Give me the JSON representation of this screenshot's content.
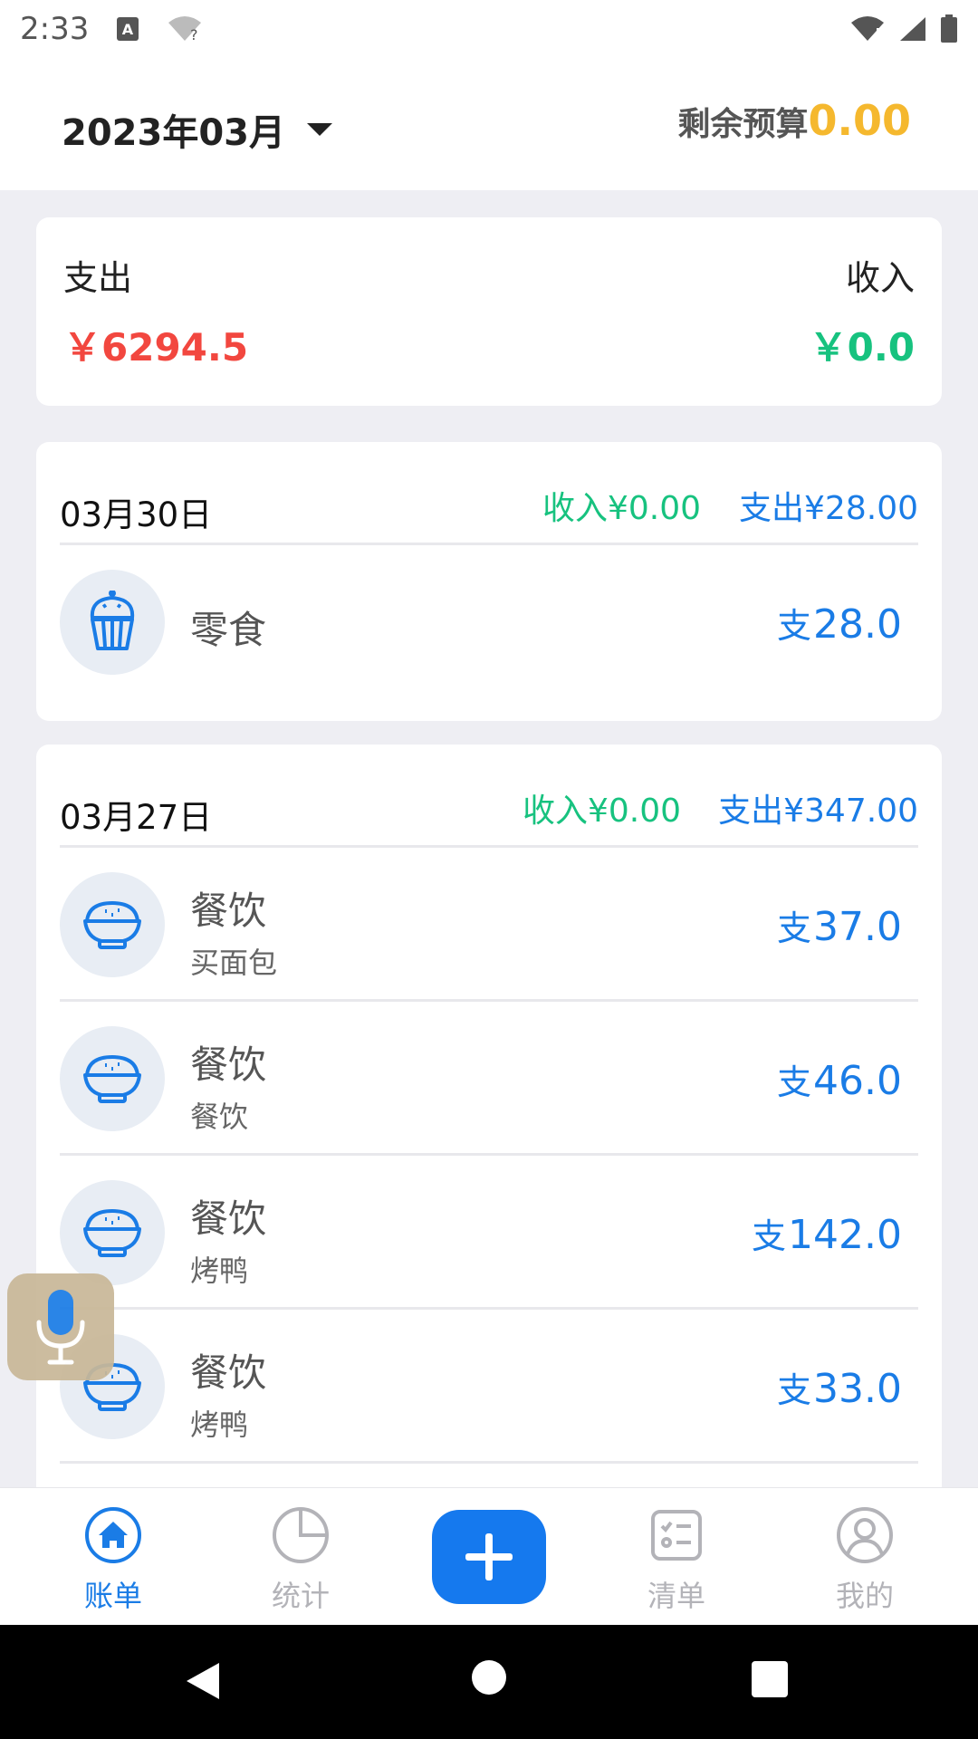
{
  "status_bar": {
    "time": "2:33"
  },
  "header": {
    "month": "2023年03月",
    "budget_label": "剩余预算",
    "budget_value": "0.00"
  },
  "summary": {
    "expense_label": "支出",
    "expense_value": "￥6294.5",
    "income_label": "收入",
    "income_value": "￥0.0"
  },
  "days": [
    {
      "date": "03月30日",
      "income": "收入¥0.00",
      "expense": "支出¥28.00",
      "items": [
        {
          "icon": "cupcake-icon",
          "category": "零食",
          "note": "",
          "prefix": "支",
          "amount": "28.0"
        }
      ]
    },
    {
      "date": "03月27日",
      "income": "收入¥0.00",
      "expense": "支出¥347.00",
      "items": [
        {
          "icon": "rice-bowl-icon",
          "category": "餐饮",
          "note": "买面包",
          "prefix": "支",
          "amount": "37.0"
        },
        {
          "icon": "rice-bowl-icon",
          "category": "餐饮",
          "note": "餐饮",
          "prefix": "支",
          "amount": "46.0"
        },
        {
          "icon": "rice-bowl-icon",
          "category": "餐饮",
          "note": "烤鸭",
          "prefix": "支",
          "amount": "142.0"
        },
        {
          "icon": "rice-bowl-icon",
          "category": "餐饮",
          "note": "烤鸭",
          "prefix": "支",
          "amount": "33.0"
        }
      ]
    }
  ],
  "bottom_nav": {
    "items": [
      {
        "label": "账单",
        "icon": "home-icon",
        "active": true
      },
      {
        "label": "统计",
        "icon": "pie-chart-icon",
        "active": false
      },
      {
        "label": "",
        "icon": "plus-icon",
        "active": false
      },
      {
        "label": "清单",
        "icon": "checklist-icon",
        "active": false
      },
      {
        "label": "我的",
        "icon": "user-icon",
        "active": false
      }
    ]
  },
  "colors": {
    "accent": "#1579ee",
    "expense_red": "#f2473f",
    "income_green": "#17c27f",
    "budget_yellow": "#f5b82e"
  }
}
